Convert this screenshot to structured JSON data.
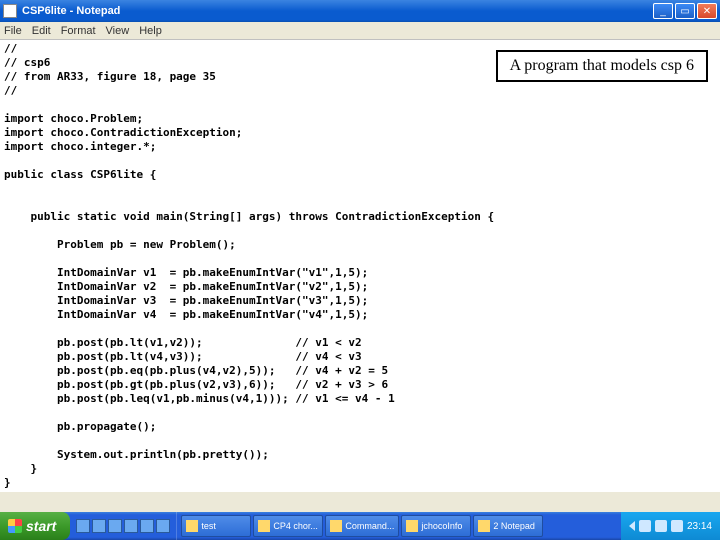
{
  "window": {
    "title": "CSP6lite - Notepad"
  },
  "menu": {
    "file": "File",
    "edit": "Edit",
    "format": "Format",
    "view": "View",
    "help": "Help"
  },
  "annotation": "A program that models csp 6",
  "code": "//\n// csp6\n// from AR33, figure 18, page 35\n//\n\nimport choco.Problem;\nimport choco.ContradictionException;\nimport choco.integer.*;\n\npublic class CSP6lite {\n\n\n    public static void main(String[] args) throws ContradictionException {\n\n        Problem pb = new Problem();\n\n        IntDomainVar v1  = pb.makeEnumIntVar(\"v1\",1,5);\n        IntDomainVar v2  = pb.makeEnumIntVar(\"v2\",1,5);\n        IntDomainVar v3  = pb.makeEnumIntVar(\"v3\",1,5);\n        IntDomainVar v4  = pb.makeEnumIntVar(\"v4\",1,5);\n\n        pb.post(pb.lt(v1,v2));              // v1 < v2\n        pb.post(pb.lt(v4,v3));              // v4 < v3\n        pb.post(pb.eq(pb.plus(v4,v2),5));   // v4 + v2 = 5\n        pb.post(pb.gt(pb.plus(v2,v3),6));   // v2 + v3 > 6\n        pb.post(pb.leq(v1,pb.minus(v4,1))); // v1 <= v4 - 1\n\n        pb.propagate();\n\n        System.out.println(pb.pretty());\n    }\n}",
  "taskbar": {
    "start": "start",
    "items": [
      {
        "label": "test"
      },
      {
        "label": "CP4 chor..."
      },
      {
        "label": "Command..."
      },
      {
        "label": "jchocoInfo"
      },
      {
        "label": "2 Notepad"
      }
    ],
    "clock": "23:14"
  }
}
